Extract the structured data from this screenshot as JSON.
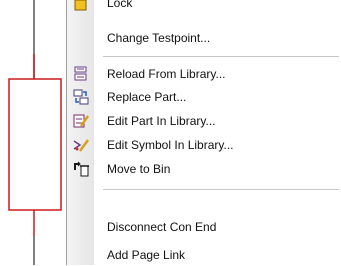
{
  "schematic": {
    "component_color": "#cc1a1a",
    "lead_color": "#555555"
  },
  "menu": {
    "items": [
      {
        "label": "Lock",
        "icon": "lock-icon"
      },
      {
        "label": "Change Testpoint...",
        "icon": ""
      },
      {
        "label": "Reload From Library...",
        "icon": "reload-library-icon"
      },
      {
        "label": "Replace Part...",
        "icon": "replace-part-icon"
      },
      {
        "label": "Edit Part In Library...",
        "icon": "edit-part-icon"
      },
      {
        "label": "Edit Symbol In Library...",
        "icon": "edit-symbol-icon"
      },
      {
        "label": "Move to Bin",
        "icon": "move-to-bin-icon"
      },
      {
        "label": "Disconnect Con End",
        "icon": ""
      },
      {
        "label": "Add Page Link",
        "icon": ""
      }
    ]
  }
}
